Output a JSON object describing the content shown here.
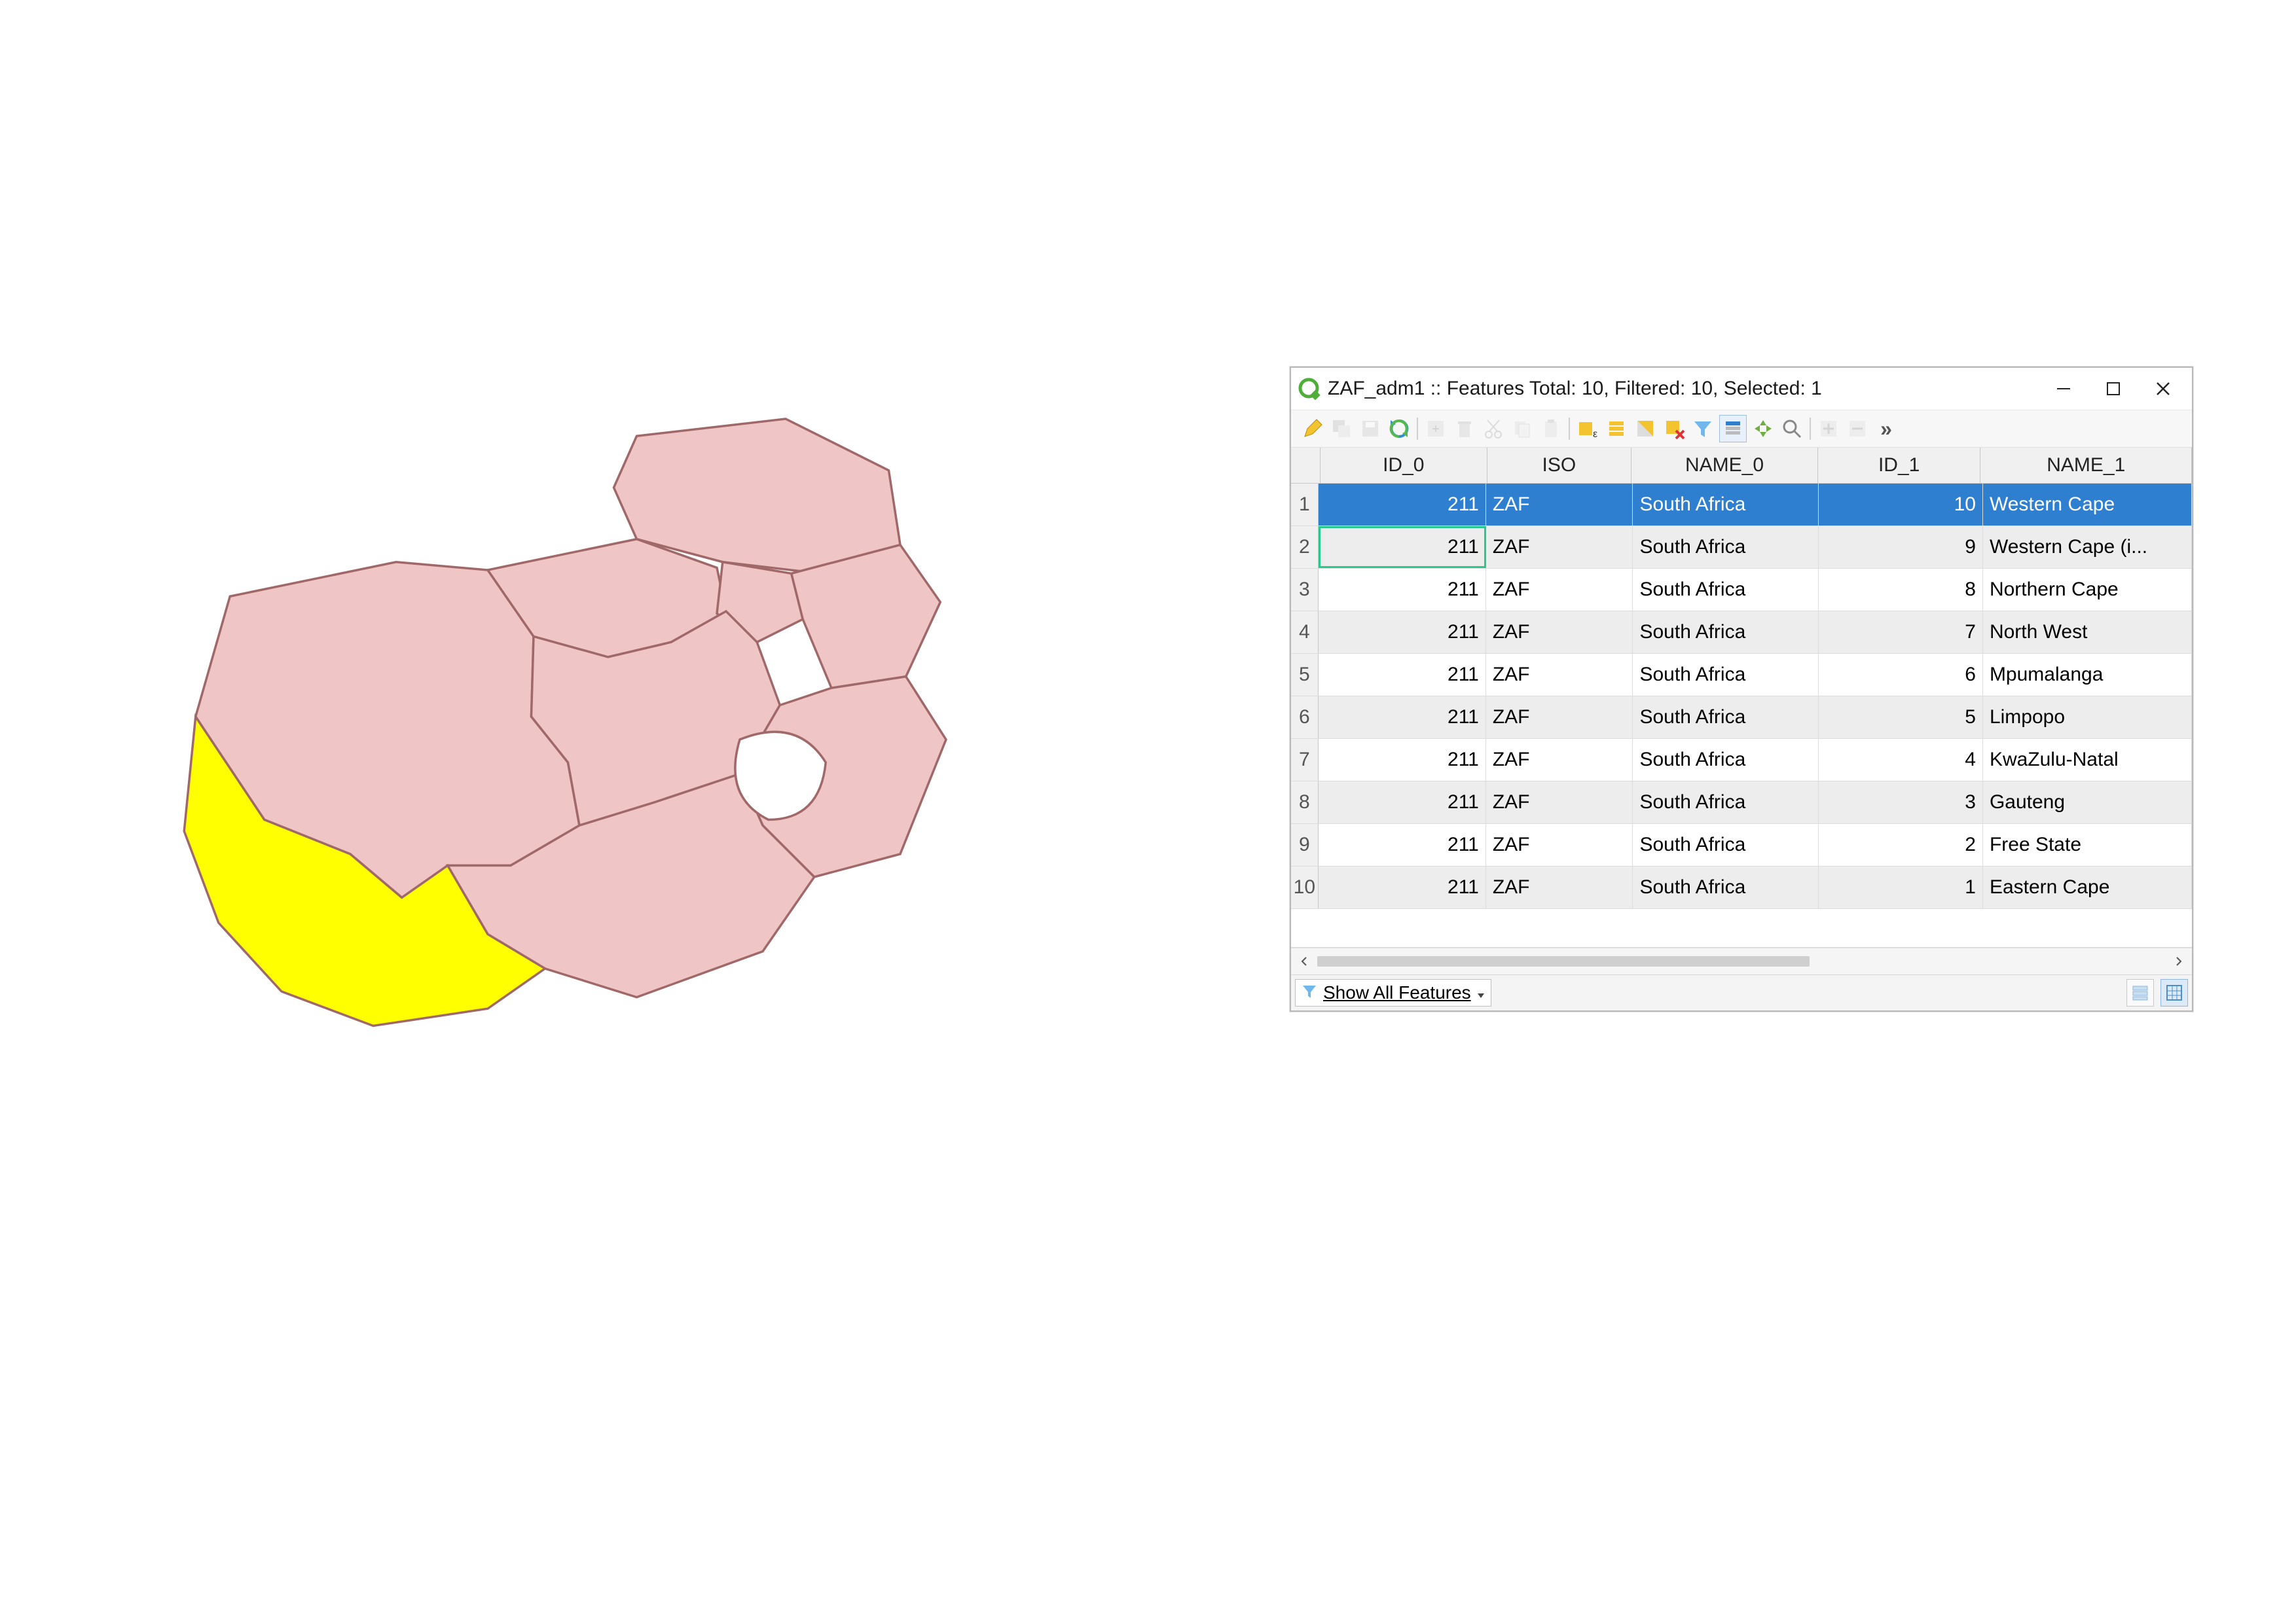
{
  "map": {
    "selected_province": "Western Cape",
    "fill": "#f0c5c5",
    "stroke": "#a06868",
    "selected_fill": "#ffff00"
  },
  "window": {
    "title": "ZAF_adm1 :: Features Total: 10, Filtered: 10, Selected: 1",
    "toolbar_overflow": "»"
  },
  "table": {
    "columns": [
      "ID_0",
      "ISO",
      "NAME_0",
      "ID_1",
      "NAME_1"
    ],
    "rows": [
      {
        "n": "1",
        "id0": "211",
        "iso": "ZAF",
        "name0": "South Africa",
        "id1": "10",
        "name1": "Western Cape",
        "selected": true
      },
      {
        "n": "2",
        "id0": "211",
        "iso": "ZAF",
        "name0": "South Africa",
        "id1": "9",
        "name1": "Western Cape (i...",
        "focus": true
      },
      {
        "n": "3",
        "id0": "211",
        "iso": "ZAF",
        "name0": "South Africa",
        "id1": "8",
        "name1": "Northern Cape"
      },
      {
        "n": "4",
        "id0": "211",
        "iso": "ZAF",
        "name0": "South Africa",
        "id1": "7",
        "name1": "North West"
      },
      {
        "n": "5",
        "id0": "211",
        "iso": "ZAF",
        "name0": "South Africa",
        "id1": "6",
        "name1": "Mpumalanga"
      },
      {
        "n": "6",
        "id0": "211",
        "iso": "ZAF",
        "name0": "South Africa",
        "id1": "5",
        "name1": "Limpopo"
      },
      {
        "n": "7",
        "id0": "211",
        "iso": "ZAF",
        "name0": "South Africa",
        "id1": "4",
        "name1": "KwaZulu-Natal"
      },
      {
        "n": "8",
        "id0": "211",
        "iso": "ZAF",
        "name0": "South Africa",
        "id1": "3",
        "name1": "Gauteng"
      },
      {
        "n": "9",
        "id0": "211",
        "iso": "ZAF",
        "name0": "South Africa",
        "id1": "2",
        "name1": "Free State"
      },
      {
        "n": "10",
        "id0": "211",
        "iso": "ZAF",
        "name0": "South Africa",
        "id1": "1",
        "name1": "Eastern Cape"
      }
    ]
  },
  "statusbar": {
    "filter_dropdown": "Show All Features"
  }
}
